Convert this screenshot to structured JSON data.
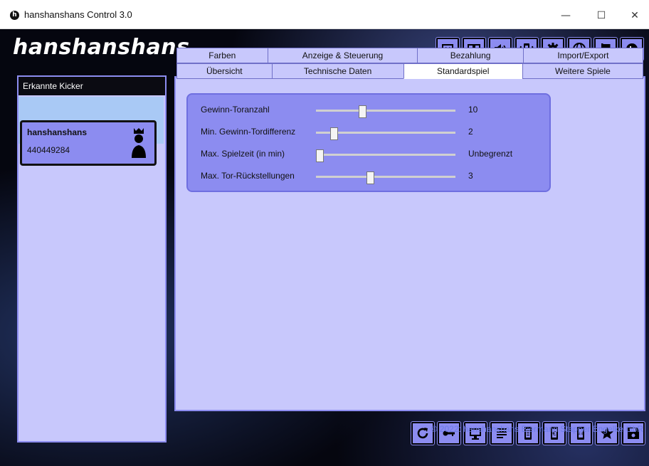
{
  "window": {
    "title": "hanshanshans Control 3.0",
    "app_icon": "h",
    "minimize": "—",
    "maximize": "☐",
    "close": "✕"
  },
  "header": {
    "logo": "hanshanshans",
    "toolbar_icons": [
      "scoreboard-icon",
      "book-icon",
      "speaker-icon",
      "connection-icon",
      "gear-icon",
      "globe-icon",
      "flag-icon",
      "logo-h-icon"
    ]
  },
  "sidebar": {
    "title": "Erkannte Kicker",
    "kickers": [
      {
        "name": "hanshanshans",
        "id": "440449284",
        "icon": "king-icon"
      }
    ]
  },
  "tabs": {
    "row1": [
      "Farben",
      "Anzeige & Steuerung",
      "Bezahlung",
      "Import/Export"
    ],
    "row2": [
      "Übersicht",
      "Technische Daten",
      "Standardspiel",
      "Weitere Spiele"
    ],
    "active": "Standardspiel"
  },
  "settings": [
    {
      "label": "Gewinn-Toranzahl",
      "value_text": "10",
      "position": 0.32
    },
    {
      "label": "Min. Gewinn-Tordifferenz",
      "value_text": "2",
      "position": 0.11
    },
    {
      "label": "Max. Spielzeit (in min)",
      "value_text": "Unbegrenzt",
      "position": 0.0
    },
    {
      "label": "Max. Tor-Rückstellungen",
      "value_text": "3",
      "position": 0.38
    }
  ],
  "footer": {
    "bottom_icons": [
      "refresh-icon",
      "key-icon",
      "scoreboard-icon",
      "list-icon",
      "phone-list-icon",
      "euro-device-icon",
      "score-device-icon",
      "star-icon",
      "save-icon"
    ],
    "copyright": "© 2022: hanshanshans Biermann Stapper Engelke GbR"
  },
  "colors": {
    "accent": "#8c8cf0",
    "panel": "#c8c8fc",
    "background": "#05060f"
  }
}
